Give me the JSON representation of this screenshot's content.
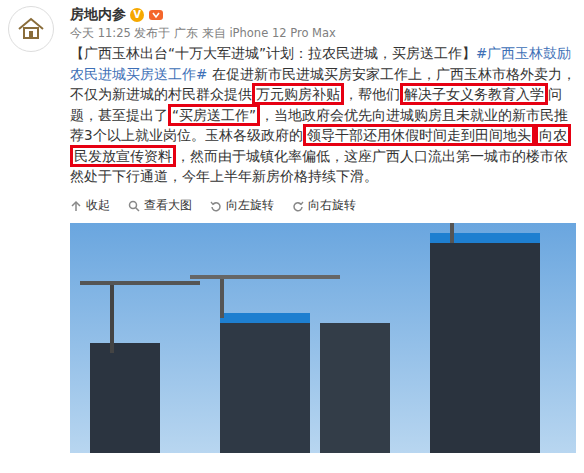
{
  "post": {
    "author": "房地内参",
    "verified_badge": "V",
    "meta": "今天 11:25 发布于 广东 来自 iPhone 12 Pro Max",
    "segments": [
      {
        "text": "【广西玉林出台“十万大军进城”计划：拉农民进城，买房送工作】",
        "kind": "plain"
      },
      {
        "text": "#广西玉林鼓励农民进城买房送工作#",
        "kind": "hashtag"
      },
      {
        "text": " 在促进新市民进城买房安家工作上，广西玉林市格外卖力，不仅为新进城的村民群众提供",
        "kind": "plain"
      },
      {
        "text": "万元购房补贴",
        "kind": "highlight"
      },
      {
        "text": "，帮他们",
        "kind": "plain"
      },
      {
        "text": "解决子女义务教育入学",
        "kind": "highlight"
      },
      {
        "text": "问题，甚至提出了",
        "kind": "plain"
      },
      {
        "text": "“买房送工作”",
        "kind": "highlight"
      },
      {
        "text": "，当地政府会优先向进城购房且未就业的新市民推荐3个以上就业岗位。玉林各级政府的",
        "kind": "plain"
      },
      {
        "text": "领导干部还用休假时间走到田间地头",
        "kind": "highlight"
      },
      {
        "text": "向农民发放宣传资料",
        "kind": "highlight"
      },
      {
        "text": "，然而由于城镇化率偏低，这座广西人口流出第一城市的楼市依然处于下行通道，今年上半年新房价格持续下滑。",
        "kind": "plain"
      }
    ]
  },
  "toolbar": [
    {
      "label": "收起"
    },
    {
      "label": "查看大图"
    },
    {
      "label": "向左旋转"
    },
    {
      "label": "向右旋转"
    }
  ]
}
